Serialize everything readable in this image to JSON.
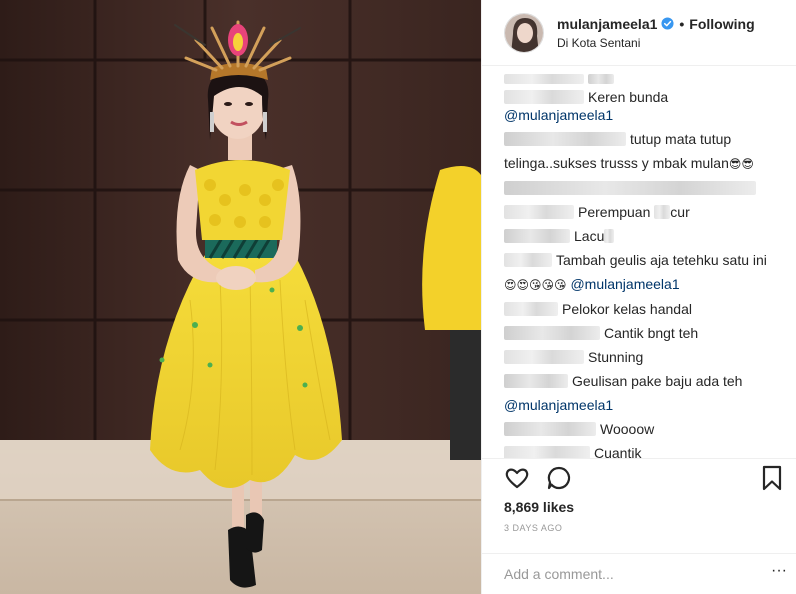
{
  "post": {
    "username": "mulanjameela1",
    "verified": true,
    "follow_status": "Following",
    "separator": "•",
    "location": "Di Kota Sentani",
    "likes": "8,869 likes",
    "time": "3 DAYS AGO",
    "comment_placeholder": "Add a comment...",
    "more": "···"
  },
  "comments": [
    {
      "blur": 80,
      "parts": [
        {
          "t": "Keren bunda "
        },
        {
          "t": "@mulanjameela1",
          "m": true
        }
      ],
      "indent": 80
    },
    {
      "blur": 122,
      "parts": [
        {
          "t": "tutup mata tutup"
        }
      ]
    },
    {
      "blur": 0,
      "parts": [
        {
          "t": "telinga..sukses trusss y mbak mulan"
        },
        {
          "t": "😎😎",
          "e": true
        }
      ]
    },
    {
      "blur": 252,
      "parts": [
        {
          "t": ""
        }
      ]
    },
    {
      "blur": 70,
      "parts": [
        {
          "t": "Perempuan "
        },
        {
          "t": "",
          "b": 16
        },
        {
          "t": "cur"
        }
      ]
    },
    {
      "blur": 66,
      "parts": [
        {
          "t": "Lacu"
        },
        {
          "t": "",
          "b": 10
        }
      ]
    },
    {
      "blur": 48,
      "parts": [
        {
          "t": "Tambah geulis aja tetehku satu ini"
        }
      ]
    },
    {
      "blur": 0,
      "parts": [
        {
          "t": "😍😍😘😘😘",
          "e": true
        },
        {
          "t": " "
        },
        {
          "t": "@mulanjameela1",
          "m": true
        }
      ]
    },
    {
      "blur": 54,
      "parts": [
        {
          "t": "Pelokor kelas handal"
        }
      ]
    },
    {
      "blur": 96,
      "parts": [
        {
          "t": "Cantik bngt teh"
        }
      ]
    },
    {
      "blur": 80,
      "parts": [
        {
          "t": "Stunning"
        }
      ]
    },
    {
      "blur": 64,
      "parts": [
        {
          "t": "Geulisan pake baju ada teh"
        }
      ]
    },
    {
      "blur": 0,
      "parts": [
        {
          "t": "@mulanjameela1",
          "m": true
        }
      ]
    },
    {
      "blur": 92,
      "parts": [
        {
          "t": "Woooow"
        }
      ]
    },
    {
      "blur": 86,
      "parts": [
        {
          "t": "Cuantik"
        }
      ]
    }
  ],
  "icons": {
    "like": "heart-icon",
    "comment": "comment-icon",
    "save": "bookmark-icon",
    "verified": "verified-badge-icon"
  },
  "colors": {
    "dress_yellow": "#f2d633",
    "wall": "#3b2622",
    "verified_blue": "#3897f0",
    "mention": "#003569",
    "muted": "#999999"
  }
}
